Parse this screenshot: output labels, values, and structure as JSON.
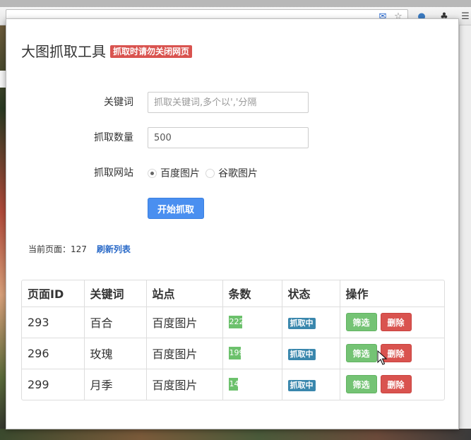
{
  "popup": {
    "title": "大图抓取工具",
    "warning_badge": "抓取时请勿关闭网页"
  },
  "form": {
    "keyword_label": "关键词",
    "keyword_placeholder": "抓取关键词,多个以','分隔",
    "keyword_value": "",
    "count_label": "抓取数量",
    "count_value": "500",
    "site_label": "抓取网站",
    "site_options": [
      "百度图片",
      "谷歌图片"
    ],
    "site_selected": "百度图片",
    "start_button": "开始抓取"
  },
  "status_line": {
    "current_page_label": "当前页面：",
    "current_page_value": "127",
    "refresh_link": "刷新列表"
  },
  "table": {
    "headers": [
      "页面ID",
      "关键词",
      "站点",
      "条数",
      "状态",
      "操作"
    ],
    "rows": [
      {
        "id": "293",
        "keyword": "百合",
        "site": "百度图片",
        "progress_text": "222/500",
        "progress": 0.44,
        "status": "抓取中",
        "filter_label": "筛选",
        "delete_label": "删除"
      },
      {
        "id": "296",
        "keyword": "玫瑰",
        "site": "百度图片",
        "progress_text": "199/500",
        "progress": 0.4,
        "status": "抓取中",
        "filter_label": "筛选",
        "delete_label": "删除"
      },
      {
        "id": "299",
        "keyword": "月季",
        "site": "百度图片",
        "progress_text": "149/500",
        "progress": 0.3,
        "status": "抓取中",
        "filter_label": "筛选",
        "delete_label": "删除"
      }
    ]
  },
  "colors": {
    "primary": "#4a8ff0",
    "success": "#74c374",
    "danger": "#d9534f",
    "info": "#3a87ad"
  },
  "icons": {
    "toolbar": [
      "envelope-icon",
      "star-icon",
      "globe-icon",
      "extension-icon",
      "menu-icon"
    ]
  }
}
